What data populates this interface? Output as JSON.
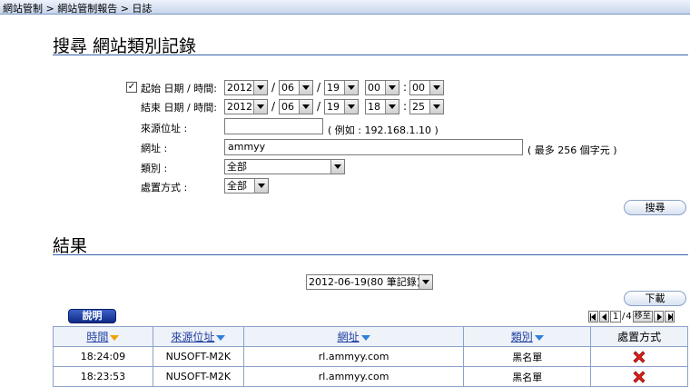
{
  "breadcrumb": "網站管制 > 網站管制報告 > 日誌",
  "search_section": {
    "title": "搜尋 網站類別記錄",
    "start": {
      "checked": true,
      "check_mark": "✓",
      "label": "起始 日期 / 時間:",
      "year": "2012",
      "month": "06",
      "day": "19",
      "hour": "00",
      "minute": "00"
    },
    "end": {
      "label": "結束 日期 / 時間:",
      "year": "2012",
      "month": "06",
      "day": "19",
      "hour": "18",
      "minute": "25"
    },
    "date_separator": "/",
    "time_separator": ":",
    "source_ip": {
      "label": "來源位址 :",
      "value": "",
      "hint": "( 例如 : 192.168.1.10 )"
    },
    "url": {
      "label": "網址 :",
      "value": "ammyy",
      "hint": "( 最多 256 個字元 )"
    },
    "category": {
      "label": "類別 :",
      "selected": "全部"
    },
    "action": {
      "label": "處置方式 :",
      "selected": "全部"
    },
    "search_button": "搜尋"
  },
  "results_section": {
    "title": "結果",
    "date_select": "2012-06-19(80 筆記錄)",
    "download_button": "下載",
    "help_button": "說明",
    "pager": {
      "current_page": "1",
      "separator": "/",
      "total_pages": "4",
      "go_label": "移至"
    },
    "columns": [
      "時間",
      "來源位址",
      "網址",
      "類別",
      "處置方式"
    ],
    "rows": [
      {
        "time": "18:24:09",
        "source": "NUSOFT-M2K",
        "url": "rl.ammyy.com",
        "category": "黑名單",
        "action": "blocked"
      },
      {
        "time": "18:23:53",
        "source": "NUSOFT-M2K",
        "url": "rl.ammyy.com",
        "category": "黑名單",
        "action": "blocked"
      }
    ]
  },
  "colors": {
    "accent": "#3a63a8",
    "header_link": "#1f3fa0",
    "sort_active": "#f0a000",
    "sort_inactive": "#2f7fd8",
    "blocked": "#e0201a"
  }
}
